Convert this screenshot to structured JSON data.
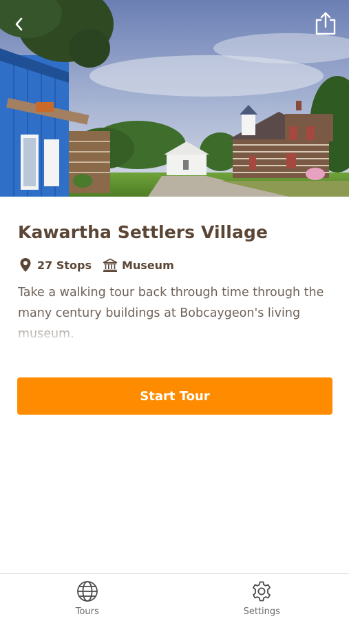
{
  "hero": {
    "image": "village-photo",
    "back_icon": "chevron-left-icon",
    "share_icon": "share-icon"
  },
  "tour": {
    "title": "Kawartha Settlers Village",
    "stops": "27 Stops",
    "stops_icon": "map-pin-icon",
    "category": "Museum",
    "category_icon": "museum-icon",
    "description": "Take a walking tour back through time through the many century buildings at Bobcaygeon's living museum."
  },
  "actions": {
    "start_label": "Start Tour",
    "start_color": "#ff8c00"
  },
  "tabbar": {
    "tabs": [
      {
        "label": "Tours",
        "icon": "globe-icon"
      },
      {
        "label": "Settings",
        "icon": "gear-icon"
      }
    ]
  }
}
